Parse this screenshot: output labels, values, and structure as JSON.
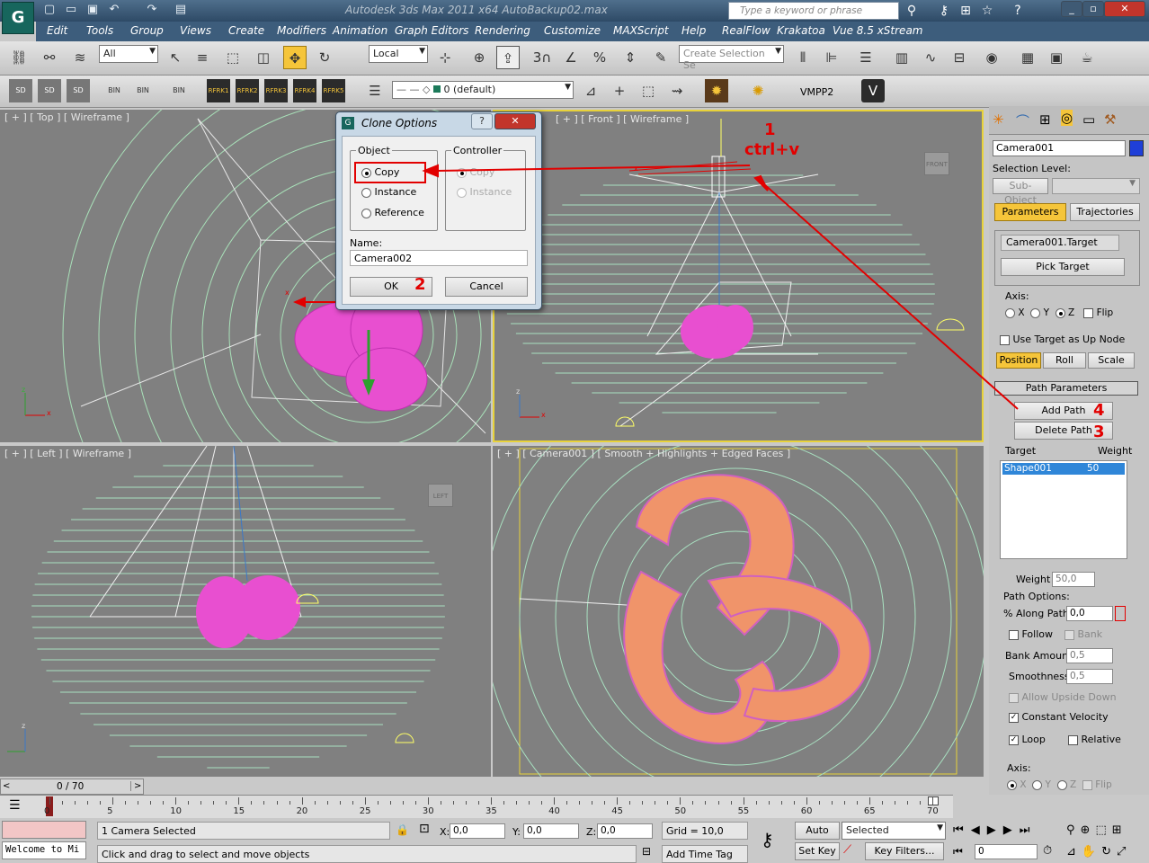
{
  "window": {
    "title": "Autodesk 3ds Max  2011 x64       AutoBackup02.max",
    "search_placeholder": "Type a keyword or phrase",
    "app_icon": "3ds-max-icon"
  },
  "menu": [
    "Edit",
    "Tools",
    "Group",
    "Views",
    "Create",
    "Modifiers",
    "Animation",
    "Graph Editors",
    "Rendering",
    "Customize",
    "MAXScript",
    "Help",
    "RealFlow",
    "Krakatoa",
    "Vue 8.5 xStream"
  ],
  "toolbar": {
    "filter": "All",
    "coord": "Local",
    "selection_set_placeholder": "Create Selection Se",
    "snap_num": "3",
    "angle_snap": "%"
  },
  "toolbar2": {
    "layer": "0 (default)",
    "vmpp": "VMPP2",
    "rf_icons": [
      "RFRK1",
      "RFRK2",
      "RFRK3",
      "RFRK4",
      "RFRK5"
    ],
    "sd_labels": [
      "SD",
      "SD",
      "SD"
    ],
    "bin_labels": [
      "BIN",
      "BIN",
      "BIN"
    ]
  },
  "viewports": {
    "top": "[ + ] [ Top ] [ Wireframe ]",
    "front": "[ + ] [ Front ] [ Wireframe ]",
    "left": "[ + ] [ Left ] [ Wireframe ]",
    "camera": "[ + ] [ Camera001 ] [ Smooth + Highlights + Edged Faces ]",
    "viewcube_front": "FRONT",
    "viewcube_left": "LEFT"
  },
  "dialog": {
    "title": "Clone Options",
    "object_group": "Object",
    "controller_group": "Controller",
    "object_options": [
      "Copy",
      "Instance",
      "Reference"
    ],
    "controller_options": [
      "Copy",
      "Instance"
    ],
    "name_label": "Name:",
    "name_value": "Camera002",
    "ok": "OK",
    "cancel": "Cancel",
    "help": "?",
    "close": "✕"
  },
  "annotations": {
    "n1": "1",
    "ctrlv": "ctrl+v",
    "n2": "2",
    "n3": "3",
    "n4": "4"
  },
  "panel": {
    "object_name": "Camera001",
    "selection_level": "Selection Level:",
    "sub_object": "Sub-Object",
    "tab_parameters": "Parameters",
    "tab_trajectories": "Trajectories",
    "target_field": "Camera001.Target",
    "pick_target": "Pick Target",
    "axis_label": "Axis:",
    "axes": [
      "X",
      "Y",
      "Z"
    ],
    "flip": "Flip",
    "use_target_up": "Use Target as Up Node",
    "position": "Position",
    "roll": "Roll",
    "scale": "Scale",
    "path_params": "Path Parameters",
    "add_path": "Add Path",
    "delete_path": "Delete Path",
    "target_col": "Target",
    "weight_col": "Weight",
    "list_target": "Shape001",
    "list_weight": "50",
    "weight_label": "Weight",
    "weight_value": "50,0",
    "path_options": "Path Options:",
    "along_path_label": "% Along Path:",
    "along_path_value": "0,0",
    "follow": "Follow",
    "bank": "Bank",
    "bank_amount_label": "Bank Amount:",
    "bank_amount_value": "0,5",
    "smoothness_label": "Smoothness:",
    "smoothness_value": "0,5",
    "allow_upside": "Allow Upside Down",
    "constant_velocity": "Constant Velocity",
    "loop": "Loop",
    "relative": "Relative",
    "axis2_label": "Axis:"
  },
  "timeline": {
    "frame": "0 / 70",
    "ticks": [
      "0",
      "5",
      "10",
      "15",
      "20",
      "25",
      "30",
      "35",
      "40",
      "45",
      "50",
      "55",
      "60",
      "65",
      "70"
    ]
  },
  "status": {
    "listener": "Welcome to Mi",
    "selected": "1 Camera Selected",
    "prompt": "Click and drag to select and move objects",
    "x_label": "X:",
    "x": "0,0",
    "y_label": "Y:",
    "y": "0,0",
    "z_label": "Z:",
    "z": "0,0",
    "grid": "Grid = 10,0",
    "add_time_tag": "Add Time Tag",
    "auto_key": "Auto Key",
    "set_key": "Set Key",
    "selected_dd": "Selected",
    "key_filters": "Key Filters...",
    "frame_field": "0"
  },
  "colors": {
    "viewport_bg": "#808080",
    "accent_yellow": "#f5c53a",
    "annotation_red": "#e20000",
    "mesh_pink": "#e84fd0",
    "torus_orange": "#f0946a"
  }
}
